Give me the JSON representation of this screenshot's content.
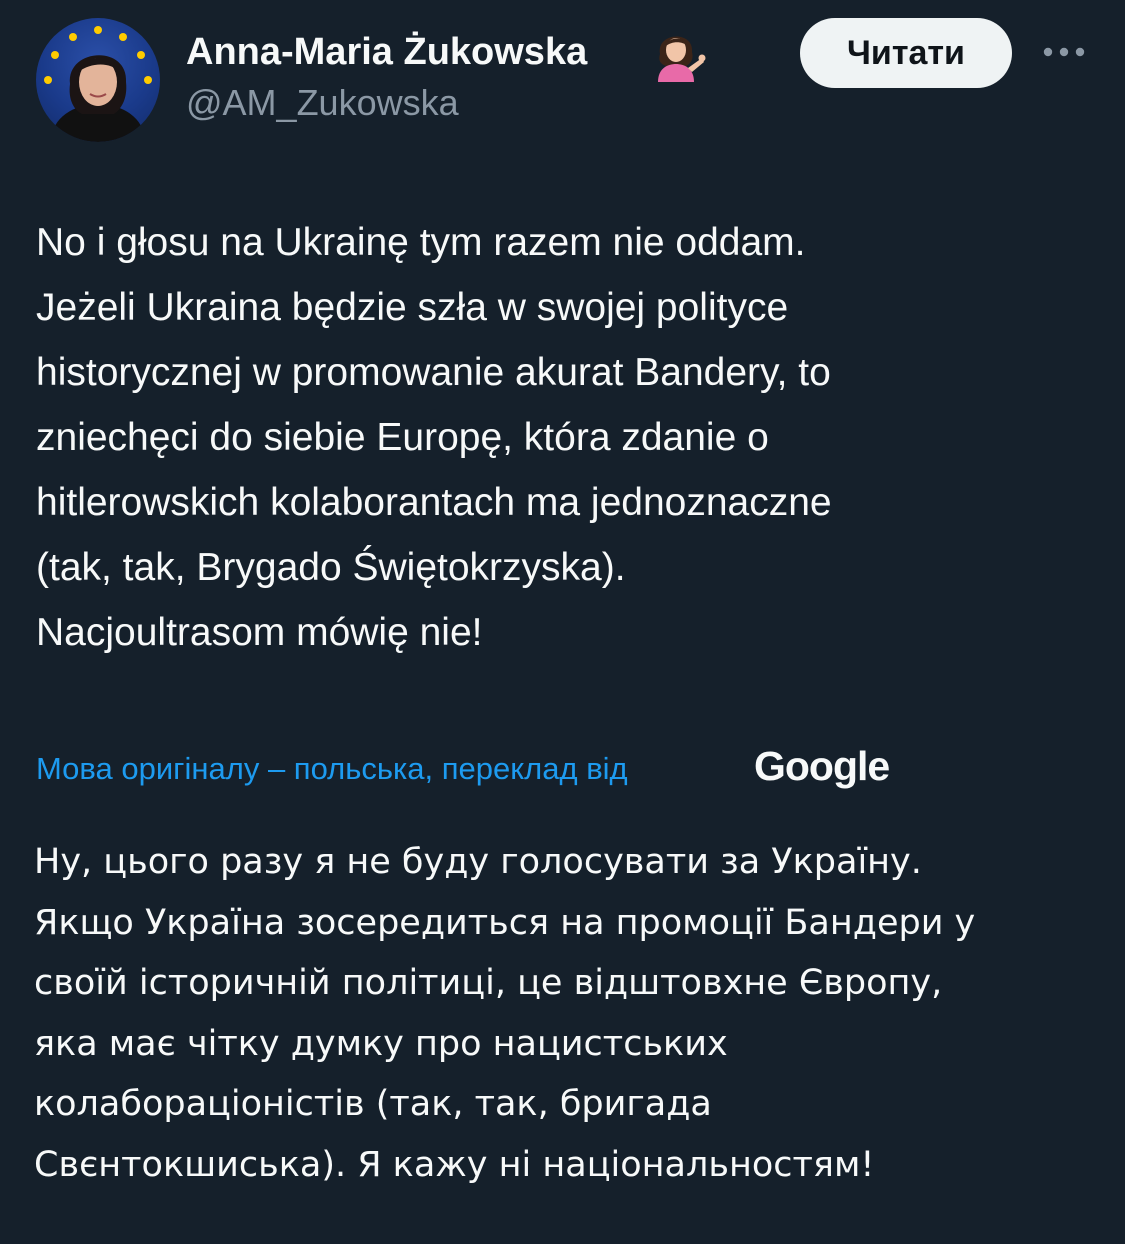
{
  "author": {
    "display_name": "Anna-Maria Żukowska",
    "handle": "@AM_Zukowska",
    "emoji_icon": "woman-tipping-hand-icon",
    "avatar_icon": "eu-flag-portrait-avatar"
  },
  "actions": {
    "follow_label": "Читати",
    "more_icon": "more-dots-icon"
  },
  "tweet": {
    "text": "No i głosu na Ukrainę tym razem nie oddam.\nJeżeli Ukraina będzie szła w swojej polityce\nhistorycznej w promowanie akurat Bandery, to\nzniechęci do siebie Europę, która zdanie o\nhitlerowskich kolaborantach ma jednoznaczne\n(tak, tak, Brygado Świętokrzyska).\nNacjoultrasom mówię nie!"
  },
  "translation": {
    "note": "Мова оригіналу – польська, переклад від",
    "provider": "Google",
    "text": "Ну, цього разу я не буду голосувати за Україну.\nЯкщо Україна зосередиться на промоції Бандери у\nсвоїй історичній політиці, це відштовхне Європу,\nяка має чітку думку про нацистських\nколабораціоністів (так, так, бригада\nСвєнтокшиська). Я кажу ні національностям!"
  },
  "colors": {
    "background": "#15202b",
    "text_primary": "#f7f9f9",
    "text_secondary": "#8b98a5",
    "link": "#1d9bf0",
    "button_bg": "#eff3f4",
    "button_text": "#0f1419",
    "eu_blue": "#1a3a8a",
    "eu_star": "#ffcc00"
  }
}
